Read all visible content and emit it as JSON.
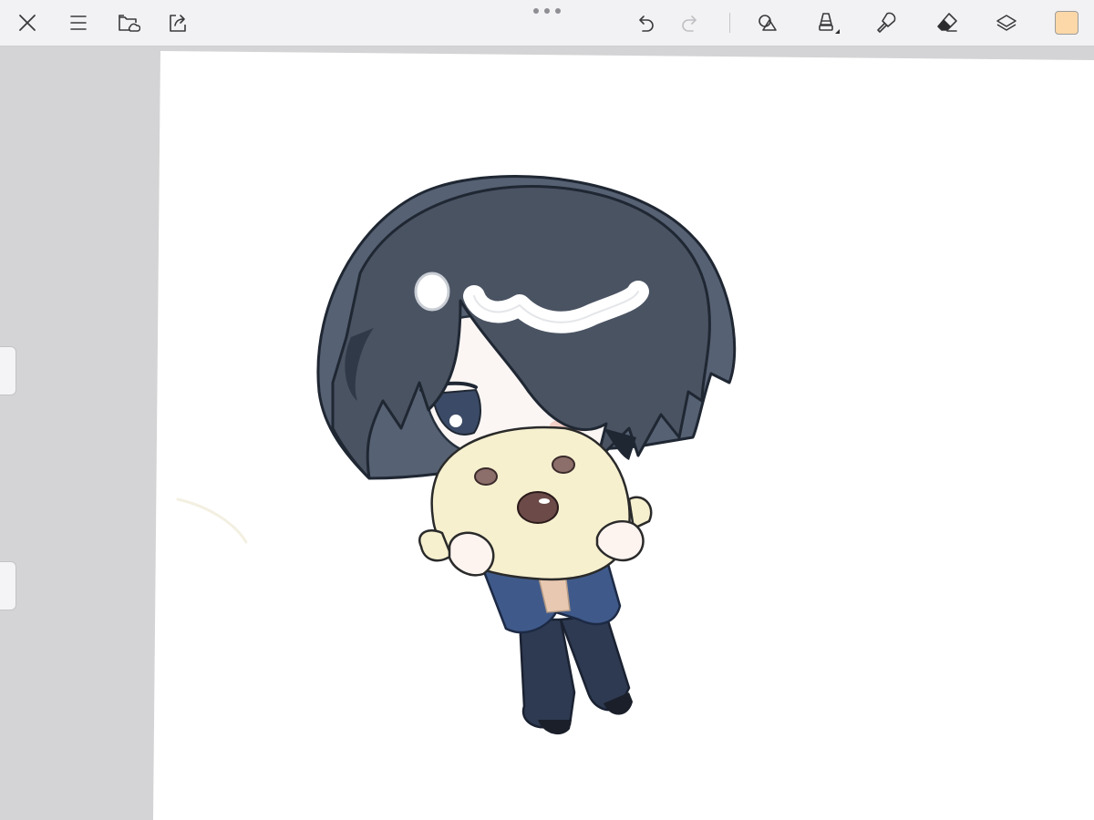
{
  "toolbar": {
    "close_icon": "close-icon",
    "menu_icon": "menu-icon",
    "gallery_icon": "folder-cloud-icon",
    "share_icon": "export-icon",
    "grabber_icon": "more-dots-icon",
    "undo_icon": "undo-icon",
    "redo_icon": "redo-icon",
    "shapes_icon": "shapes-icon",
    "brush_icon": "brush-icon",
    "fill_icon": "fill-icon",
    "eraser_icon": "eraser-icon",
    "layers_icon": "layers-icon"
  },
  "current_color": "#fcd8a8",
  "colors": {
    "toolbar_bg": "#f2f2f4",
    "workspace_bg": "#d4d4d6",
    "canvas_bg": "#ffffff",
    "icon": "#3a3a3c",
    "icon_disabled": "#c0c0c4"
  }
}
